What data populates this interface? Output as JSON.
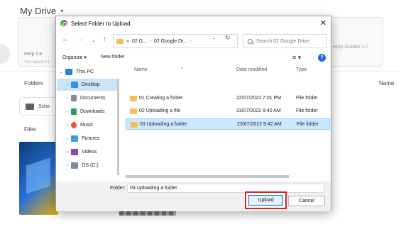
{
  "drive": {
    "title": "My Drive",
    "caret": "▾",
    "card_left_text": "Help Ce",
    "card_left_sub": "You opened t",
    "card_right_text": "Help Guides v.2",
    "folders_label": "Folders",
    "name_label": "Name",
    "folder_chip": "Scho",
    "files_label": "Files"
  },
  "dialog": {
    "title": "Select Folder to Upload",
    "close": "✕",
    "nav": {
      "back": "←",
      "forward": "→",
      "dropdown": "⌄",
      "up": "↑"
    },
    "address": {
      "prefix": "«",
      "segments": [
        "02 G...",
        "02 Google Dr..."
      ],
      "sep": "›",
      "dropdown": "⌄",
      "refresh": "↻"
    },
    "search": {
      "placeholder": "Search 02 Google Drive"
    },
    "toolbar": {
      "organize": "Organize ▾",
      "new_folder": "New folder",
      "view": "≡ ▾",
      "help": "?"
    },
    "nav_pane": [
      {
        "label": "This PC",
        "expander": "⌄",
        "color": "#2b7fd6"
      },
      {
        "label": "Desktop",
        "expander": "›",
        "color": "#3a8ee6",
        "selected": true
      },
      {
        "label": "Documents",
        "expander": "›",
        "color": "#8a8a8a"
      },
      {
        "label": "Downloads",
        "expander": "›",
        "color": "#2a9b57"
      },
      {
        "label": "Music",
        "expander": "›",
        "color": "#e0583a"
      },
      {
        "label": "Pictures",
        "expander": "›",
        "color": "#3d9be9"
      },
      {
        "label": "Videos",
        "expander": "›",
        "color": "#8e44ad"
      },
      {
        "label": "OS (C:)",
        "expander": "›",
        "color": "#7a8aa0"
      }
    ],
    "columns": {
      "name": "Name",
      "date": "Date modified",
      "type": "Type",
      "sort_caret": "^"
    },
    "files": [
      {
        "name": "01 Creating a folder",
        "date": "22/07/2022 7:01 PM",
        "type": "File folder"
      },
      {
        "name": "02 Uploading a file",
        "date": "23/07/2022 9:40 AM",
        "type": "File folder"
      },
      {
        "name": "03 Uploading a folder",
        "date": "23/07/2022 9:42 AM",
        "type": "File folder",
        "selected": true
      }
    ],
    "folder_label": "Folder:",
    "folder_value": "03 Uploading a folder",
    "upload": "Upload",
    "cancel": "Cancel"
  }
}
